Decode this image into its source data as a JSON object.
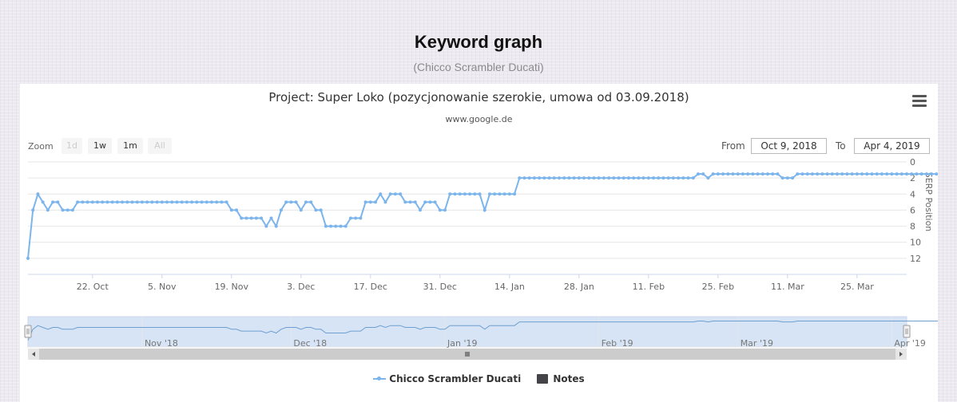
{
  "page": {
    "title": "Keyword graph",
    "subtitle": "(Chicco Scrambler Ducati)"
  },
  "toolbar": {
    "zoom_label": "Zoom",
    "zoom_buttons": [
      {
        "label": "1d",
        "enabled": false
      },
      {
        "label": "1w",
        "enabled": true
      },
      {
        "label": "1m",
        "enabled": true
      },
      {
        "label": "All",
        "enabled": false
      }
    ],
    "from_label": "From",
    "from_value": "Oct 9, 2018",
    "to_label": "To",
    "to_value": "Apr 4, 2019"
  },
  "legend": {
    "series_label": "Chicco Scrambler Ducati",
    "notes_label": "Notes"
  },
  "colors": {
    "series": "#7cb5ec",
    "notes": "#434348",
    "navigator_fill": "#d6e4f5"
  },
  "icons": {
    "menu": "hamburger-menu-icon"
  },
  "chart_data": {
    "type": "line",
    "title": "Project: Super Loko (pozycjonowanie szerokie, umowa od 03.09.2018)",
    "subtitle": "www.google.de",
    "ylabel": "SERP Position",
    "y_reversed": true,
    "y_axis_side": "right",
    "ylim": [
      0,
      14
    ],
    "yticks": [
      0,
      2,
      4,
      6,
      8,
      10,
      12
    ],
    "xlim": [
      "2018-10-09",
      "2019-04-04"
    ],
    "xticks": [
      {
        "date": "2018-10-22",
        "label": "22. Oct"
      },
      {
        "date": "2018-11-05",
        "label": "5. Nov"
      },
      {
        "date": "2018-11-19",
        "label": "19. Nov"
      },
      {
        "date": "2018-12-03",
        "label": "3. Dec"
      },
      {
        "date": "2018-12-17",
        "label": "17. Dec"
      },
      {
        "date": "2018-12-31",
        "label": "31. Dec"
      },
      {
        "date": "2019-01-14",
        "label": "14. Jan"
      },
      {
        "date": "2019-01-28",
        "label": "28. Jan"
      },
      {
        "date": "2019-02-11",
        "label": "11. Feb"
      },
      {
        "date": "2019-02-25",
        "label": "25. Feb"
      },
      {
        "date": "2019-03-11",
        "label": "11. Mar"
      },
      {
        "date": "2019-03-25",
        "label": "25. Mar"
      }
    ],
    "navigator_ticks": [
      {
        "date": "2018-11-01",
        "label": "Nov '18"
      },
      {
        "date": "2018-12-01",
        "label": "Dec '18"
      },
      {
        "date": "2019-01-01",
        "label": "Jan '19"
      },
      {
        "date": "2019-02-01",
        "label": "Feb '19"
      },
      {
        "date": "2019-03-01",
        "label": "Mar '19"
      },
      {
        "date": "2019-04-01",
        "label": "Apr '19"
      }
    ],
    "grid": true,
    "series": [
      {
        "name": "Chicco Scrambler Ducati",
        "start_date": "2018-10-09",
        "values": [
          12,
          6,
          4,
          5,
          6,
          5,
          5,
          6,
          6,
          6,
          5,
          5,
          5,
          5,
          5,
          5,
          5,
          5,
          5,
          5,
          5,
          5,
          5,
          5,
          5,
          5,
          5,
          5,
          5,
          5,
          5,
          5,
          5,
          5,
          5,
          5,
          5,
          5,
          5,
          5,
          5,
          6,
          6,
          7,
          7,
          7,
          7,
          7,
          8,
          7,
          8,
          6,
          5,
          5,
          5,
          6,
          5,
          5,
          6,
          6,
          8,
          8,
          8,
          8,
          8,
          7,
          7,
          7,
          5,
          5,
          5,
          4,
          5,
          4,
          4,
          4,
          5,
          5,
          5,
          6,
          5,
          5,
          5,
          6,
          6,
          4,
          4,
          4,
          4,
          4,
          4,
          4,
          6,
          4,
          4,
          4,
          4,
          4,
          4,
          2,
          2,
          2,
          2,
          2,
          2,
          2,
          2,
          2,
          2,
          2,
          2,
          2,
          2,
          2,
          2,
          2,
          2,
          2,
          2,
          2,
          2,
          2,
          2,
          2,
          2,
          2,
          2,
          2,
          2,
          2,
          2,
          2,
          2,
          2,
          2,
          1.5,
          1.5,
          2,
          1.5,
          1.5,
          1.5,
          1.5,
          1.5,
          1.5,
          1.5,
          1.5,
          1.5,
          1.5,
          1.5,
          1.5,
          1.5,
          1.5,
          2,
          2,
          2,
          1.5,
          1.5,
          1.5,
          1.5,
          1.5,
          1.5,
          1.5,
          1.5,
          1.5,
          1.5,
          1.5,
          1.5,
          1.5,
          1.5,
          1.5,
          1.5,
          1.5,
          1.5,
          1.5,
          1.5,
          1.5,
          1.5,
          1.5,
          1.5,
          1.5,
          1.5,
          1.5,
          1.5,
          1.5,
          1.5,
          1.5,
          1.5,
          1.5,
          1.5,
          1.5,
          1.5
        ]
      }
    ]
  }
}
